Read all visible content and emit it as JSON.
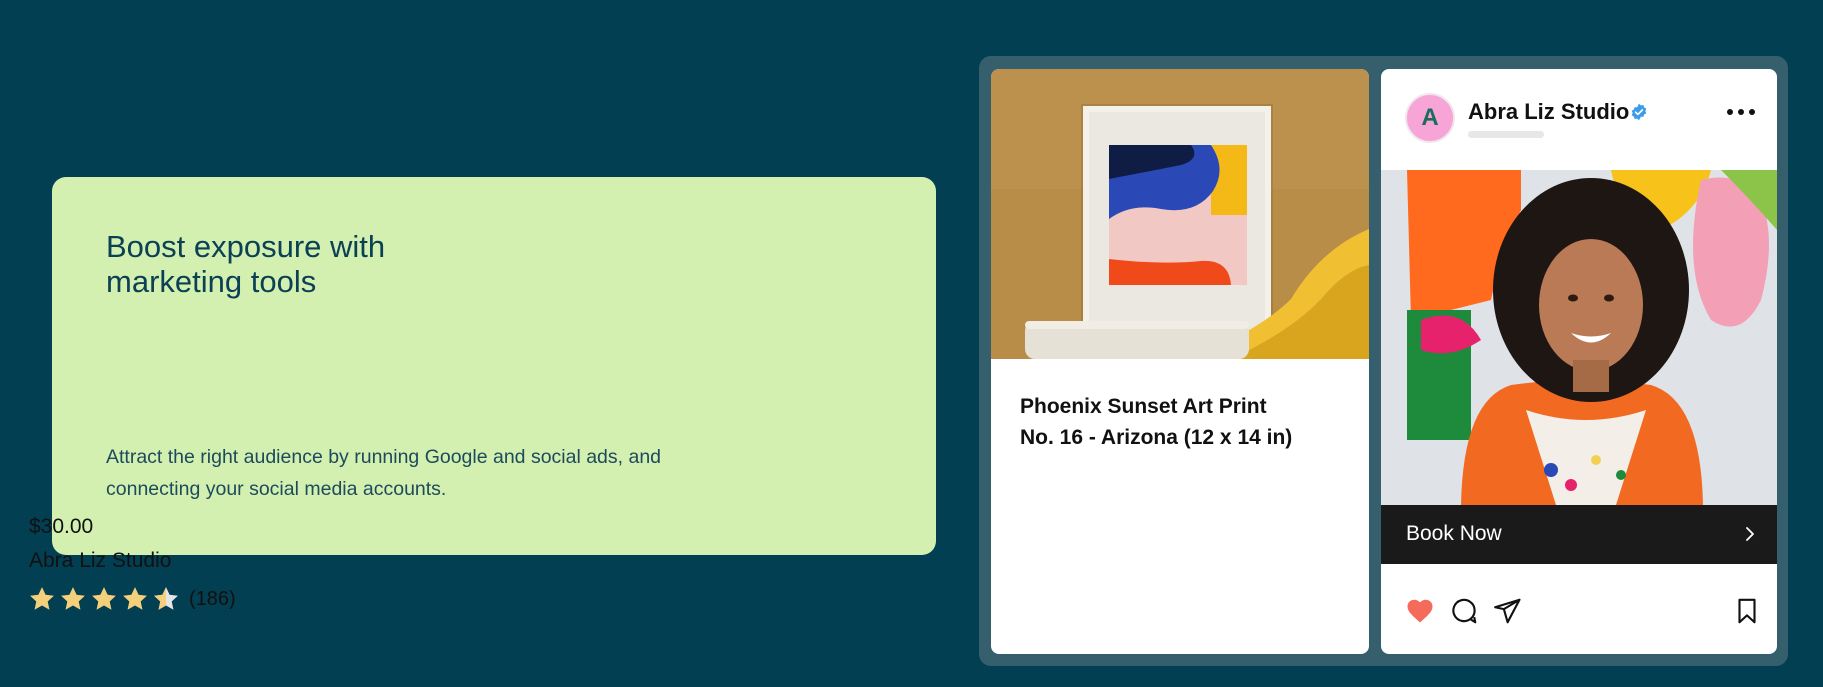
{
  "promo": {
    "title_line1": "Boost exposure with",
    "title_line2": "marketing tools",
    "description_line1": "Attract the right audience by running Google and social ads, and",
    "description_line2": "connecting your social media accounts."
  },
  "product": {
    "name_line1": "Phoenix Sunset Art Print",
    "name_line2": "No. 16 - Arizona (12 x 14 in)",
    "price": "$30.00",
    "seller": "Abra Liz Studio",
    "rating": 4.5,
    "rating_max": 5,
    "review_count": "(186)"
  },
  "post": {
    "avatar_initial": "A",
    "account_name": "Abra Liz Studio",
    "cta_label": "Book Now",
    "liked": true
  },
  "colors": {
    "background": "#023f52",
    "promo_card": "#d3f0b0",
    "promo_text": "#0b4055",
    "showcase_frame": "#365f6d",
    "star": "#f4d07a",
    "heart": "#f46a5b",
    "verified": "#3d9be9",
    "avatar": "#f7a5d6",
    "cta_bar": "#1a1a1a"
  },
  "icons": {
    "verified": "verified-badge-icon",
    "more": "more-dots-icon",
    "chevron": "chevron-right-icon",
    "like": "heart-icon",
    "comment": "comment-icon",
    "share": "send-icon",
    "save": "bookmark-icon",
    "star": "star-icon"
  }
}
